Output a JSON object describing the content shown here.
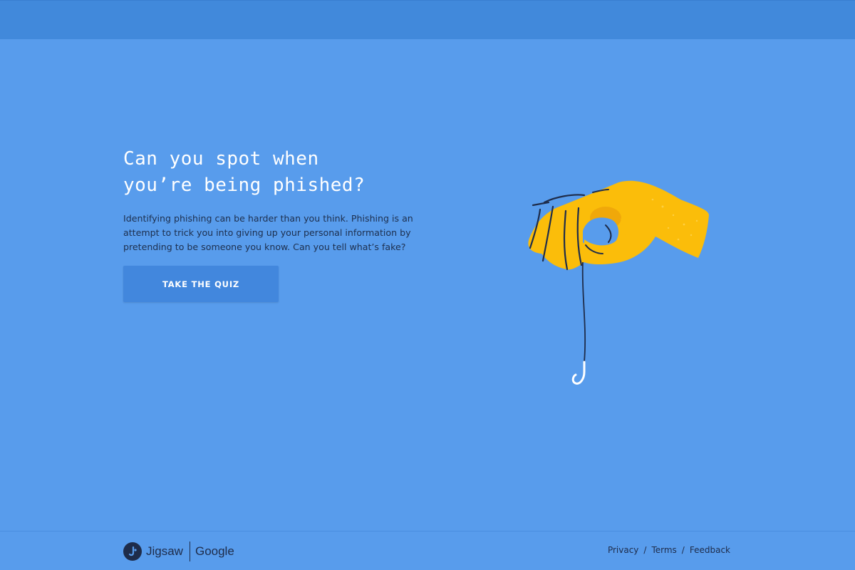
{
  "hero": {
    "title_line1": "Can you spot when",
    "title_line2": "you’re being phished?",
    "description": "Identifying phishing can be harder than you think. Phishing is an attempt to trick you into giving up your personal information by pretending to be someone you know. Can you tell what’s fake?",
    "cta_label": "TAKE THE QUIZ"
  },
  "illustration": {
    "hand_icon": "hand-holding-hook-illustration"
  },
  "footer": {
    "brand_jigsaw": "Jigsaw",
    "brand_google": "Google",
    "links": {
      "privacy": "Privacy",
      "terms": "Terms",
      "feedback": "Feedback"
    },
    "separator": "/"
  },
  "colors": {
    "background": "#589cec",
    "top_bar": "#4189db",
    "button": "#4287dd",
    "hand": "#fbbd0a",
    "text_dark": "#1e2c4a"
  }
}
